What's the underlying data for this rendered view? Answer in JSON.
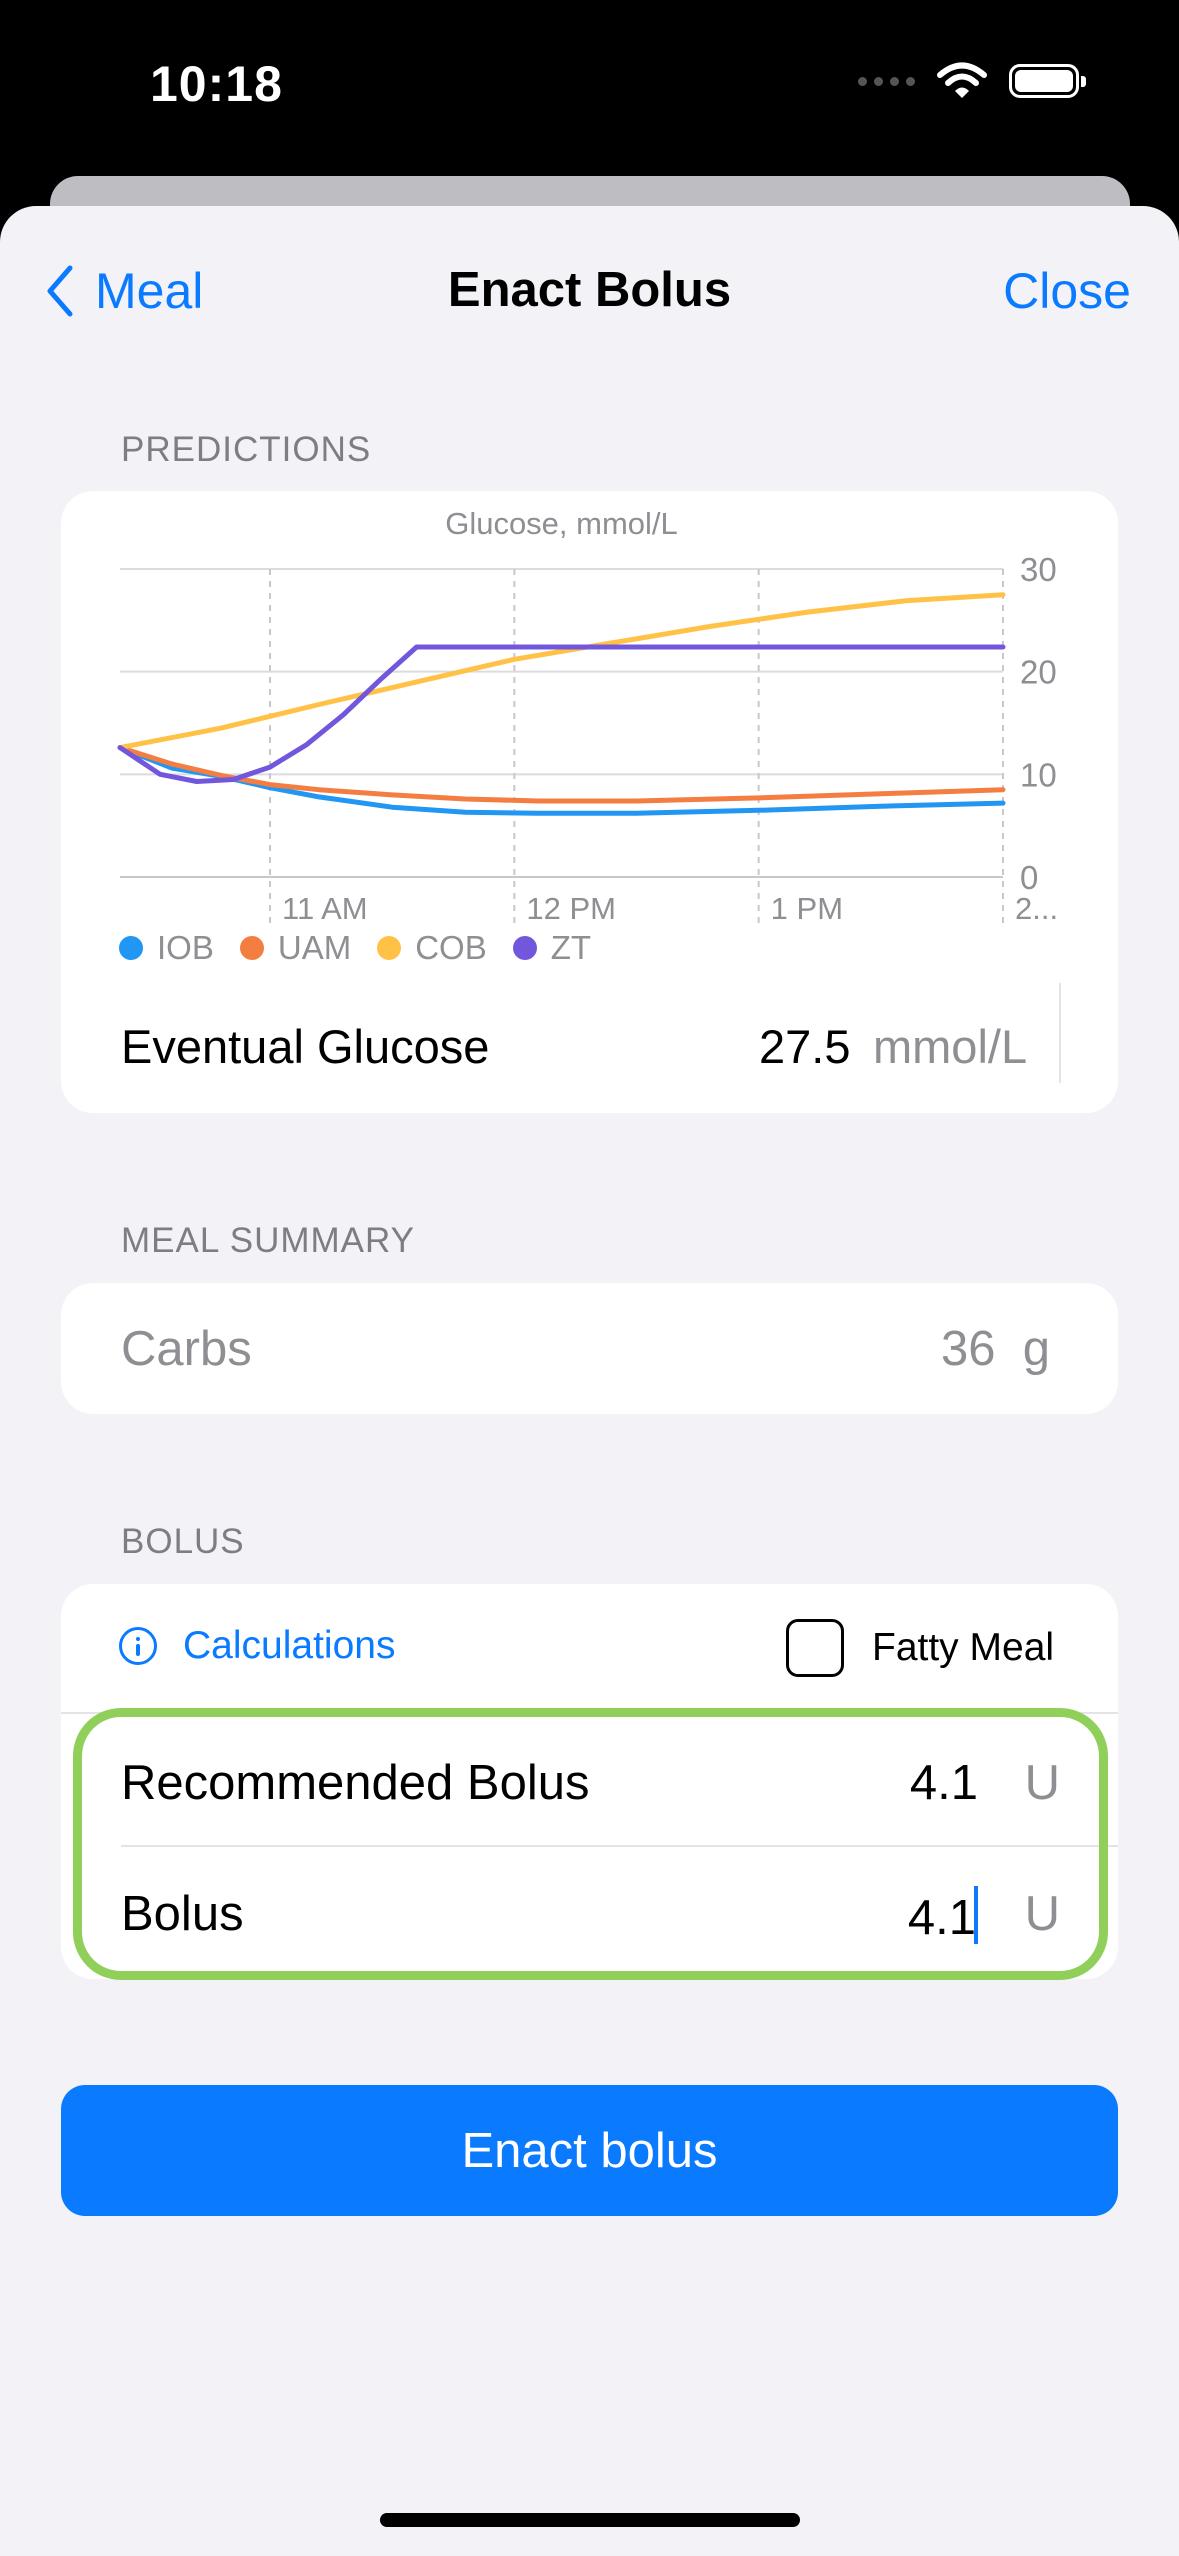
{
  "status_bar": {
    "time": "10:18"
  },
  "nav": {
    "back_label": "Meal",
    "title": "Enact Bolus",
    "close_label": "Close"
  },
  "predictions": {
    "header": "PREDICTIONS",
    "eventual_label": "Eventual Glucose",
    "eventual_value": "27.5",
    "eventual_unit": "mmol/L"
  },
  "chart_data": {
    "type": "line",
    "title": "Glucose, mmol/L",
    "ylim": [
      0,
      30
    ],
    "y_ticks": [
      "0",
      "10",
      "20",
      "30"
    ],
    "x_ticks": [
      "11 AM",
      "12 PM",
      "1 PM",
      "2..."
    ],
    "x_tick_positions_hours": [
      1,
      2,
      3,
      4
    ],
    "xlim_hours": [
      0.386,
      4.0
    ],
    "grid": true,
    "legend_placement": "bottom-left",
    "series": [
      {
        "name": "IOB",
        "color": "#2196f3",
        "x": [
          0.386,
          0.6,
          0.8,
          1.0,
          1.2,
          1.5,
          1.8,
          2.1,
          2.5,
          3.0,
          3.5,
          4.0
        ],
        "y": [
          12.6,
          10.6,
          9.8,
          8.7,
          7.8,
          6.8,
          6.3,
          6.2,
          6.2,
          6.5,
          6.9,
          7.2
        ]
      },
      {
        "name": "UAM",
        "color": "#f47e42",
        "x": [
          0.386,
          0.6,
          0.8,
          1.0,
          1.2,
          1.5,
          1.8,
          2.1,
          2.5,
          3.0,
          3.5,
          4.0
        ],
        "y": [
          12.6,
          11.0,
          9.9,
          9.0,
          8.5,
          8.0,
          7.6,
          7.4,
          7.4,
          7.7,
          8.1,
          8.5
        ]
      },
      {
        "name": "COB",
        "color": "#ffc247",
        "x": [
          0.386,
          0.8,
          1.2,
          1.6,
          2.0,
          2.4,
          2.8,
          3.2,
          3.6,
          4.0
        ],
        "y": [
          12.6,
          14.5,
          16.8,
          19.0,
          21.2,
          22.8,
          24.4,
          25.8,
          26.9,
          27.5
        ]
      },
      {
        "name": "ZT",
        "color": "#7257dd",
        "x": [
          0.386,
          0.55,
          0.7,
          0.85,
          1.0,
          1.15,
          1.3,
          1.45,
          1.6,
          1.8,
          2.2,
          3.0,
          4.0
        ],
        "y": [
          12.6,
          10.0,
          9.3,
          9.5,
          10.7,
          12.9,
          15.8,
          19.2,
          22.4,
          22.4,
          22.4,
          22.4,
          22.4
        ]
      }
    ]
  },
  "meal_summary": {
    "header": "MEAL SUMMARY",
    "carbs_label": "Carbs",
    "carbs_value": "36",
    "carbs_unit": "g"
  },
  "bolus": {
    "header": "BOLUS",
    "calculations_label": "Calculations",
    "fatty_meal_label": "Fatty Meal",
    "fatty_meal_checked": false,
    "recommended_label": "Recommended Bolus",
    "recommended_value": "4.1",
    "recommended_unit": "U",
    "bolus_label": "Bolus",
    "bolus_value": "4.1",
    "bolus_unit": "U"
  },
  "enact_button_label": "Enact bolus"
}
